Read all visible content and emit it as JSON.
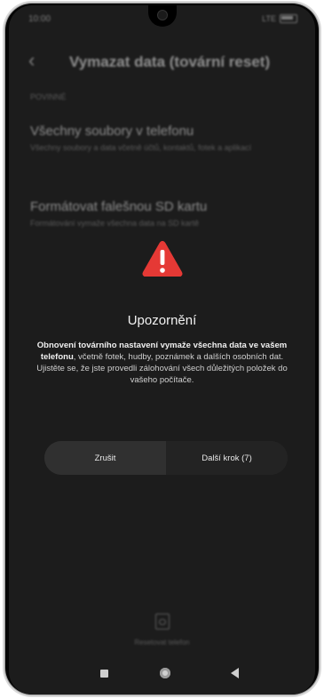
{
  "status_bar": {
    "time": "10:00",
    "signal": "LTE"
  },
  "header": {
    "back_glyph": "‹",
    "title": "Vymazat data (tovární reset)"
  },
  "section_label": "POVINNÉ",
  "options": [
    {
      "title": "Všechny soubory v telefonu",
      "description": "Všechny soubory a data včetně účtů, kontaktů, fotek a aplikací"
    },
    {
      "title": "Formátovat falešnou SD kartu",
      "description": "Formátování vymaže všechna data na SD kartě"
    }
  ],
  "dialog": {
    "icon": "warning-triangle-icon",
    "icon_color": "#e53935",
    "title": "Upozornění",
    "message_bold": "Obnovení továrního nastavení vymaže všechna data ve vašem telefonu",
    "message_rest": ", včetně fotek, hudby, poznámek a dalších osobních dat. Ujistěte se, že jste provedli zálohování všech důležitých položek do vašeho počítače.",
    "cancel_label": "Zrušit",
    "next_label": "Další krok (7)"
  },
  "bottom_action": {
    "label": "Resetovat telefon",
    "icon": "phone-reset-icon"
  },
  "nav_bar": {
    "icons": [
      "recents-square-icon",
      "home-circle-icon",
      "back-triangle-icon"
    ]
  }
}
